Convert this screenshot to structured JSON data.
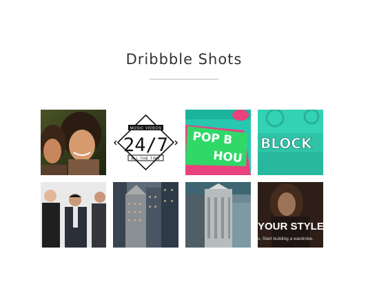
{
  "section": {
    "title": "Dribbble Shots"
  },
  "shots": [
    {
      "icon": "women-portrait-photo",
      "alt_colors": [
        "#2f3a1c",
        "#c98a5b"
      ]
    },
    {
      "icon": "music-videos-logo",
      "logo_top": "MUSIC VIDEOS",
      "logo_main": "24/7",
      "logo_bottom": "ALL THE TIME"
    },
    {
      "icon": "pop-house-lettering",
      "lettering": "POP"
    },
    {
      "icon": "block-lettering",
      "lettering": "BLOCK"
    },
    {
      "icon": "team-group-photo"
    },
    {
      "icon": "city-buildings-photo"
    },
    {
      "icon": "skyscraper-aerial-photo"
    },
    {
      "icon": "fashion-portrait-photo",
      "caption": "YOUR STYLE",
      "subcaption": "s. Start building a wardrobe."
    }
  ],
  "colors": {
    "title": "#333333",
    "divider": "#d9d9d9",
    "teal": "#2fd1b6",
    "pink": "#e8417e"
  }
}
